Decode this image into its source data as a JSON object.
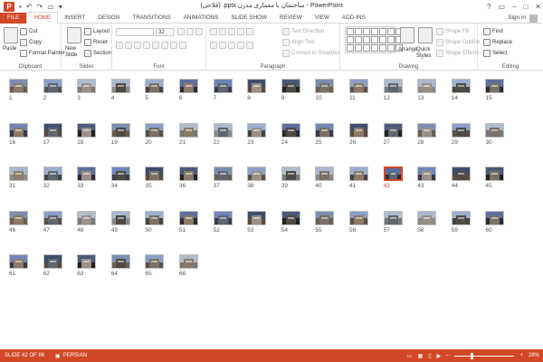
{
  "window": {
    "title": "(فلاحی) .pptx ساختمان با معماری مدرن - PowerPoint",
    "controls": [
      "?",
      "▭",
      "–",
      "□",
      "✕"
    ]
  },
  "tabs": [
    "FILE",
    "HOME",
    "INSERT",
    "DESIGN",
    "TRANSITIONS",
    "ANIMATIONS",
    "SLIDE SHOW",
    "REVIEW",
    "VIEW",
    "ADD-INS"
  ],
  "account": {
    "label": "Sign in"
  },
  "ribbon": {
    "clipboard": {
      "label": "Clipboard",
      "paste": "Paste",
      "cut": "Cut",
      "copy": "Copy",
      "format_painter": "Format Painter"
    },
    "slides": {
      "label": "Slides",
      "new_slide": "New Slide",
      "layout": "Layout",
      "reset": "Reset",
      "section": "Section"
    },
    "font": {
      "label": "Font",
      "size": "32"
    },
    "paragraph": {
      "label": "Paragraph",
      "text_direction": "Text Direction",
      "align_text": "Align Text",
      "convert": "Convert to SmartArt"
    },
    "drawing": {
      "label": "Drawing",
      "arrange": "Arrange",
      "quick_styles": "Quick Styles",
      "shape_fill": "Shape Fill",
      "shape_outline": "Shape Outline",
      "shape_effects": "Shape Effects"
    },
    "editing": {
      "label": "Editing",
      "find": "Find",
      "replace": "Replace",
      "select": "Select"
    }
  },
  "slides": {
    "count": 66,
    "selected": 42,
    "numbers": [
      "1",
      "2",
      "3",
      "4",
      "5",
      "6",
      "7",
      "8",
      "9",
      "10",
      "11",
      "12",
      "13",
      "14",
      "15",
      "16",
      "17",
      "18",
      "19",
      "20",
      "21",
      "22",
      "23",
      "24",
      "25",
      "26",
      "27",
      "28",
      "29",
      "30",
      "31",
      "32",
      "33",
      "34",
      "35",
      "36",
      "37",
      "38",
      "39",
      "40",
      "41",
      "42",
      "43",
      "44",
      "45",
      "46",
      "47",
      "48",
      "49",
      "50",
      "51",
      "52",
      "53",
      "54",
      "55",
      "56",
      "57",
      "58",
      "59",
      "60",
      "61",
      "62",
      "63",
      "64",
      "65",
      "66"
    ]
  },
  "status": {
    "slide_info": "SLIDE 42 OF 66",
    "language": "PERSIAN",
    "zoom": "28%"
  },
  "colors": {
    "accent": "#d24726"
  }
}
